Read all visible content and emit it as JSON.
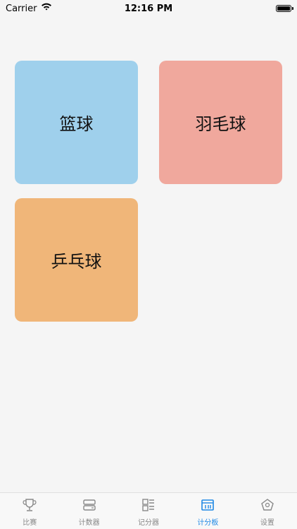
{
  "status_bar": {
    "carrier": "Carrier",
    "time": "12:16 PM"
  },
  "cards": {
    "basketball": "篮球",
    "badminton": "羽毛球",
    "pingpong": "乒乓球"
  },
  "tabs": [
    {
      "label": "比赛",
      "icon": "trophy-icon"
    },
    {
      "label": "计数器",
      "icon": "counter-icon"
    },
    {
      "label": "记分器",
      "icon": "grid-list-icon"
    },
    {
      "label": "计分板",
      "icon": "scoreboard-icon"
    },
    {
      "label": "设置",
      "icon": "pentagon-icon"
    }
  ],
  "colors": {
    "basketball": "#9fd0ec",
    "badminton": "#f0a89d",
    "pingpong": "#f0b679",
    "tab_active": "#1e88e5",
    "tab_inactive": "#888888"
  },
  "active_tab": "计分板"
}
